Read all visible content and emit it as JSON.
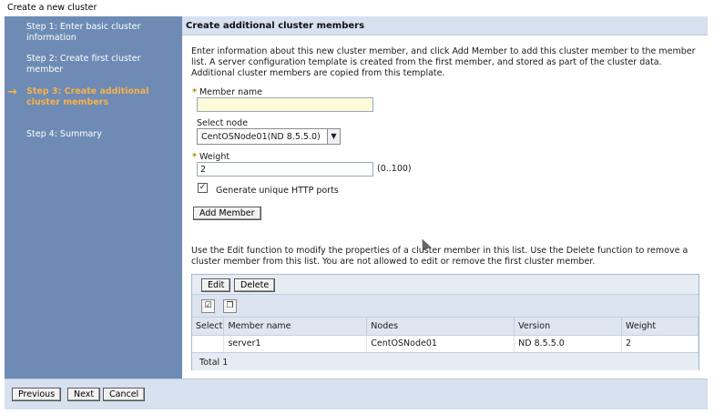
{
  "window": {
    "title": "Create a new cluster"
  },
  "wizard": {
    "steps": [
      {
        "label": "Step 1: Enter basic cluster information",
        "current": false
      },
      {
        "label": "Step 2: Create first cluster member",
        "current": false
      },
      {
        "label": "Step 3: Create additional cluster members",
        "current": true
      },
      {
        "label": "Step 4: Summary",
        "current": false
      }
    ],
    "current_arrow": "→"
  },
  "panel": {
    "title": "Create additional cluster members",
    "intro": "Enter information about this new cluster member, and click Add Member to add this cluster member to the member list. A server configuration template is created from the first member, and stored as part of the cluster data. Additional cluster members are copied from this template."
  },
  "form": {
    "required_marker": "*",
    "member_name_label": "Member name",
    "member_name_value": "",
    "select_node_label": "Select node",
    "select_node_value": "CentOSNode01(ND 8.5.5.0)",
    "weight_label": "Weight",
    "weight_value": "2",
    "weight_range": "(0..100)",
    "generate_ports_label": "Generate unique HTTP ports",
    "generate_ports_checked": true,
    "add_member_label": "Add Member"
  },
  "members": {
    "intro": "Use the Edit function to modify the properties of a cluster member in this list. Use the Delete function to remove a cluster member from this list. You are not allowed to edit or remove the first cluster member.",
    "edit_label": "Edit",
    "delete_label": "Delete",
    "columns": [
      "Select",
      "Member name",
      "Nodes",
      "Version",
      "Weight"
    ],
    "rows": [
      {
        "select": "",
        "member_name": "server1",
        "nodes": "CentOSNode01",
        "version": "ND 8.5.5.0",
        "weight": "2"
      }
    ],
    "total": "Total 1"
  },
  "footer": {
    "previous_label": "Previous",
    "next_label": "Next",
    "cancel_label": "Cancel"
  },
  "colors": {
    "sidebar_bg": "#6d8bb5",
    "current_step": "#f7b24a",
    "header_bg": "#d7e1ef",
    "required_input_bg": "#fffbd8"
  }
}
